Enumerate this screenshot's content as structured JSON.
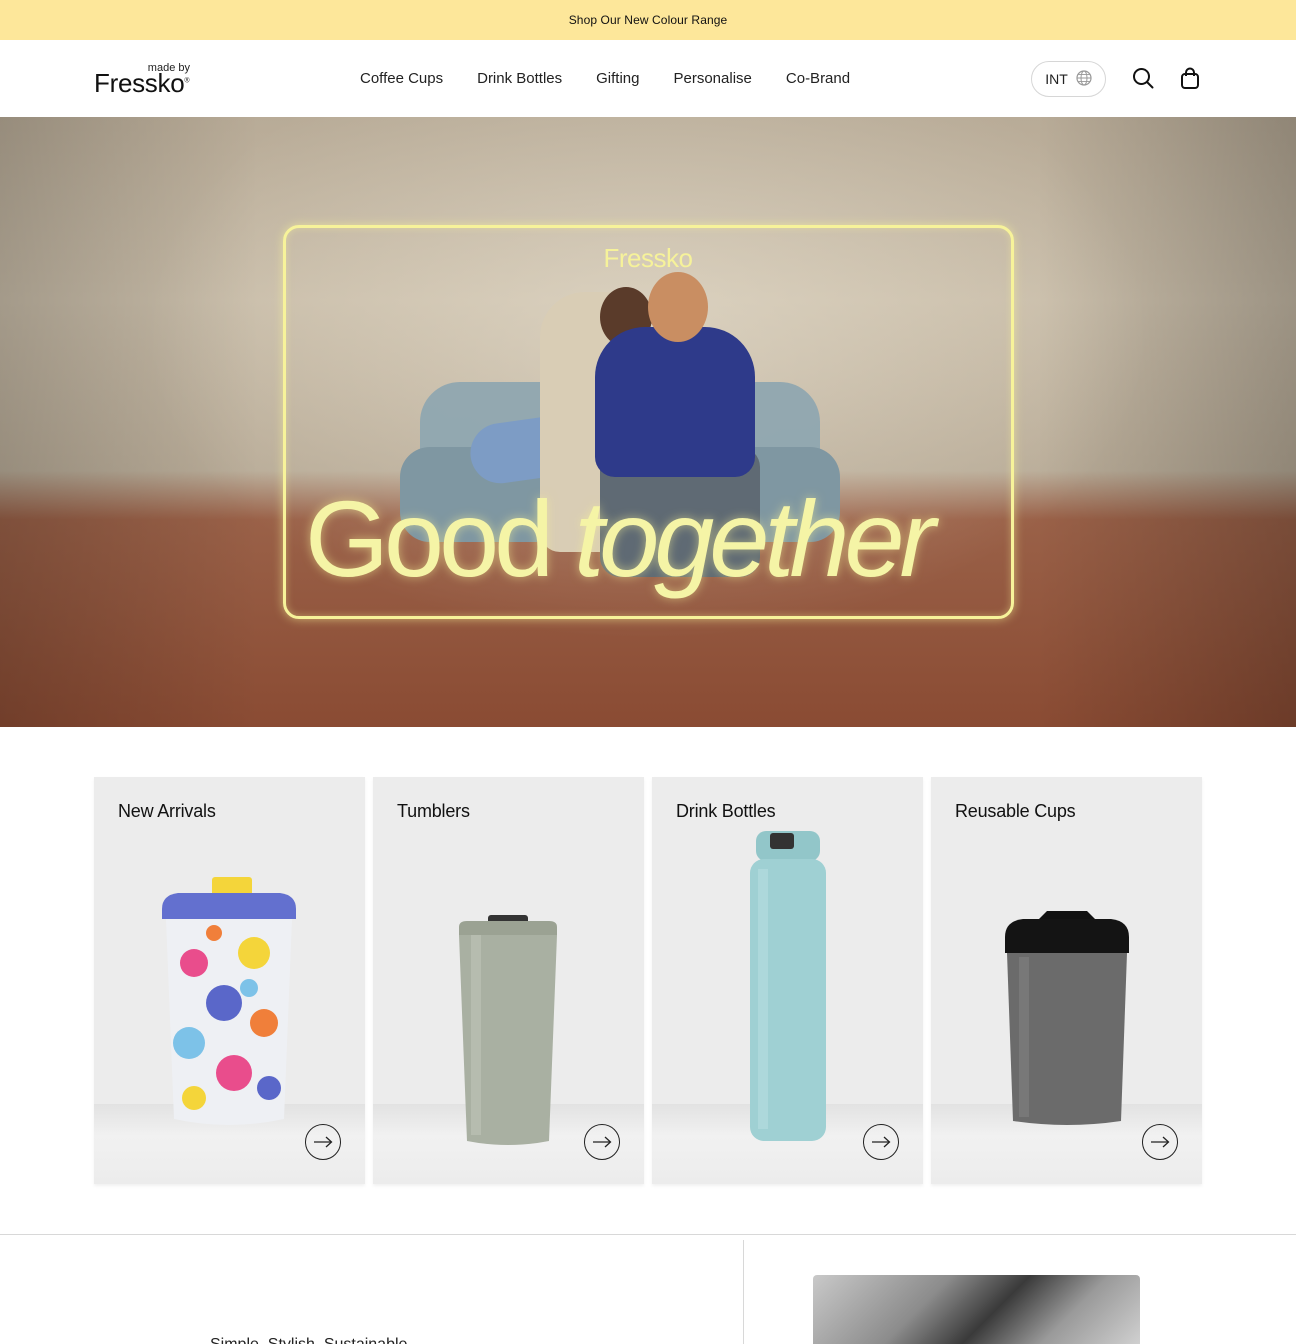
{
  "announcement": {
    "text": "Shop Our New Colour Range"
  },
  "header": {
    "logo_made_by": "made by",
    "logo_brand": "Fressko",
    "nav": [
      "Coffee Cups",
      "Drink Bottles",
      "Gifting",
      "Personalise",
      "Co-Brand"
    ],
    "currency": "INT"
  },
  "hero": {
    "brand": "Fressko",
    "title_regular": "Good",
    "title_italic": "together"
  },
  "categories": [
    {
      "title": "New Arrivals",
      "icon": "arrow-right-icon"
    },
    {
      "title": "Tumblers",
      "icon": "arrow-right-icon"
    },
    {
      "title": "Drink Bottles",
      "icon": "arrow-right-icon"
    },
    {
      "title": "Reusable Cups",
      "icon": "arrow-right-icon"
    }
  ],
  "promo": {
    "text": "Simple, Stylish, Sustainable"
  },
  "colors": {
    "announcement_bg": "#fde79a",
    "hero_accent": "#f5f4a6",
    "card_bg": "#ececec"
  }
}
